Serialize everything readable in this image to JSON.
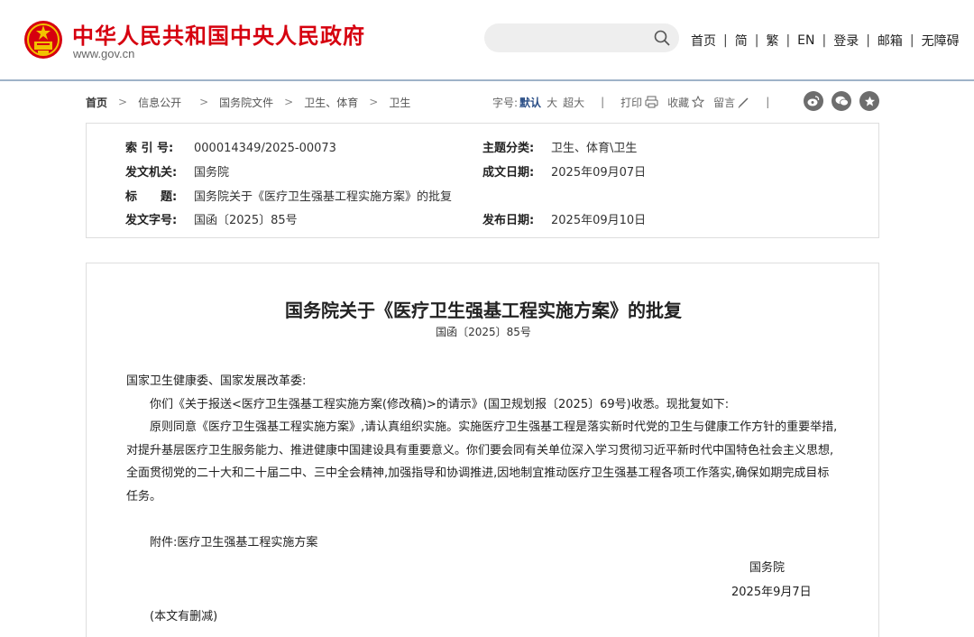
{
  "header": {
    "site_title": "中华人民共和国中央人民政府",
    "site_domain": "www.gov.cn",
    "search": {
      "placeholder": ""
    },
    "nav": [
      "首页",
      "简",
      "繁",
      "EN",
      "登录",
      "邮箱",
      "无障碍"
    ]
  },
  "breadcrumb": [
    "首页",
    "信息公开",
    "国务院文件",
    "卫生、体育",
    "卫生"
  ],
  "tools": {
    "font_label": "字号:",
    "font_default": "默认",
    "font_large": "大",
    "font_xlarge": "超大",
    "print": "打印",
    "favorite": "收藏",
    "comment": "留言"
  },
  "social_icons": [
    "weibo-icon",
    "wechat-icon",
    "favorite-star-icon"
  ],
  "meta": {
    "index_label": "索 引 号:",
    "index_value": "000014349/2025-00073",
    "category_label": "主题分类:",
    "category_value": "卫生、体育\\卫生",
    "issuer_label": "发文机关:",
    "issuer_value": "国务院",
    "written_date_label": "成文日期:",
    "written_date_value": "2025年09月07日",
    "title_label": "标　　题:",
    "title_value": "国务院关于《医疗卫生强基工程实施方案》的批复",
    "doc_no_label": "发文字号:",
    "doc_no_value": "国函〔2025〕85号",
    "publish_date_label": "发布日期:",
    "publish_date_value": "2025年09月10日"
  },
  "article": {
    "title": "国务院关于《医疗卫生强基工程实施方案》的批复",
    "doc_no": "国函〔2025〕85号",
    "salutation": "国家卫生健康委、国家发展改革委:",
    "para1": "你们《关于报送<医疗卫生强基工程实施方案(修改稿)>的请示》(国卫规划报〔2025〕69号)收悉。现批复如下:",
    "para2": "原则同意《医疗卫生强基工程实施方案》,请认真组织实施。实施医疗卫生强基工程是落实新时代党的卫生与健康工作方针的重要举措,对提升基层医疗卫生服务能力、推进健康中国建设具有重要意义。你们要会同有关单位深入学习贯彻习近平新时代中国特色社会主义思想,全面贯彻党的二十大和二十届二中、三中全会精神,加强指导和协调推进,因地制宜推动医疗卫生强基工程各项工作落实,确保如期完成目标任务。",
    "attachment": "附件:医疗卫生强基工程实施方案",
    "signature": "国务院",
    "date": "2025年9月7日",
    "note": "(本文有删减)"
  },
  "colors": {
    "brand_red": "#d6000f",
    "accent_blue": "#2a4e86"
  }
}
